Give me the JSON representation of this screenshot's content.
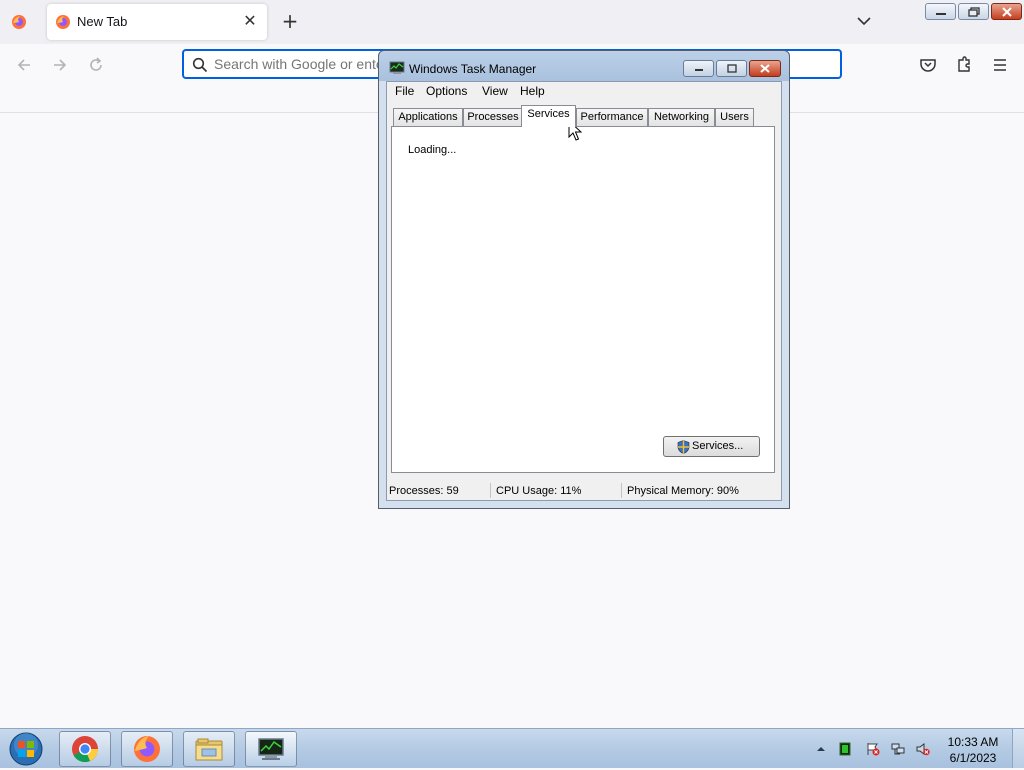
{
  "browser": {
    "tab": {
      "title": "New Tab"
    },
    "urlbar": {
      "placeholder": "Search with Google or enter address"
    }
  },
  "task_manager": {
    "title": "Windows Task Manager",
    "menu": [
      "File",
      "Options",
      "View",
      "Help"
    ],
    "tabs": [
      "Applications",
      "Processes",
      "Services",
      "Performance",
      "Networking",
      "Users"
    ],
    "active_tab": "Services",
    "loading_text": "Loading...",
    "services_button": "Services...",
    "status": {
      "processes": "Processes: 59",
      "cpu": "CPU Usage: 11%",
      "memory": "Physical Memory: 90%"
    }
  },
  "taskbar": {
    "apps": [
      "chrome-icon",
      "firefox-icon",
      "file-explorer-icon",
      "task-manager-icon"
    ],
    "clock": {
      "time": "10:33 AM",
      "date": "6/1/2023"
    }
  }
}
